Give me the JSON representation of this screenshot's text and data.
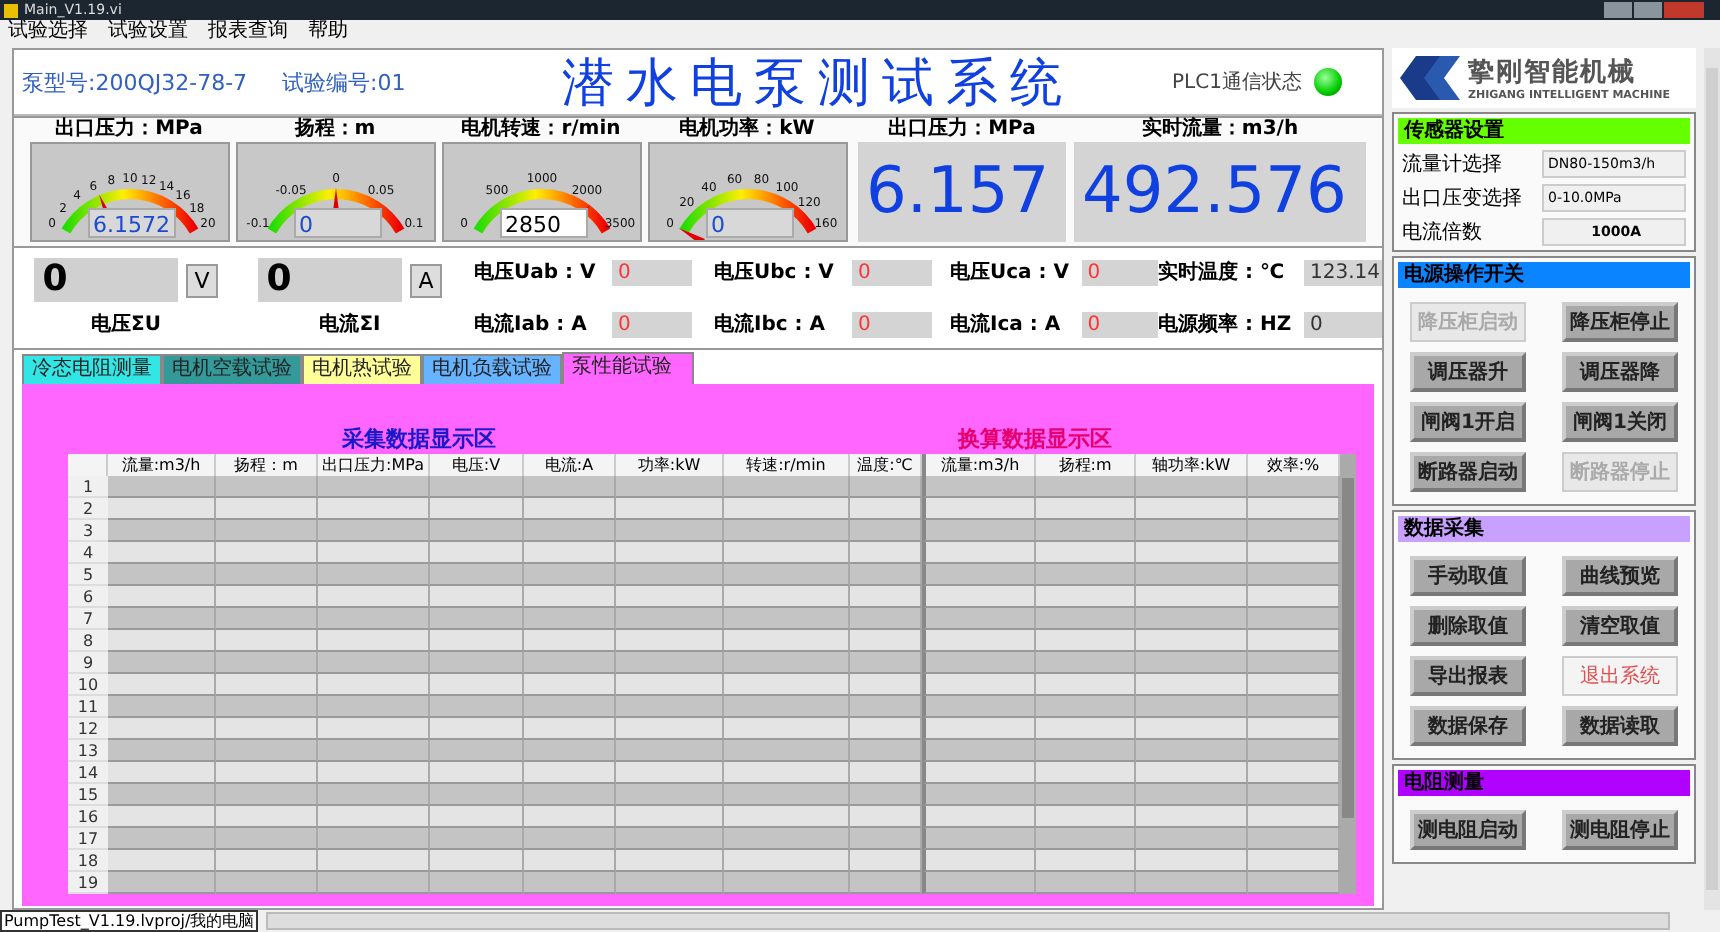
{
  "window": {
    "title": "Main_V1.19.vi"
  },
  "menu": [
    "试验选择",
    "试验设置",
    "报表查询",
    "帮助"
  ],
  "header": {
    "pump_model": "泵型号:200QJ32-78-7",
    "test_number": "试验编号:01",
    "title": "潜水电泵测试系统",
    "plc_label": "PLC1通信状态",
    "plc_ok": true
  },
  "logo": {
    "name": "挚刚智能机械",
    "subtitle": "ZHIGANG INTELLIGENT MACHINE"
  },
  "gauges": [
    {
      "label": "出口压力：MPa",
      "ticks": [
        "0",
        "2",
        "4",
        "6",
        "8",
        "10",
        "12",
        "14",
        "16",
        "18",
        "20"
      ],
      "value": "6.1572",
      "level": 0.31,
      "focused": false
    },
    {
      "label": "扬程：m",
      "ticks": [
        "-0.1",
        "-0.05",
        "0",
        "0.05",
        "0.1"
      ],
      "value": "0",
      "level": 0.5,
      "focused": false
    },
    {
      "label": "电机转速：r/min",
      "ticks": [
        "0",
        "500",
        "1000",
        "2000",
        "3500"
      ],
      "value": "2850",
      "level": 0.81,
      "focused": true
    },
    {
      "label": "电机功率：kW",
      "ticks": [
        "0",
        "20",
        "40",
        "60",
        "80",
        "100",
        "120",
        "160"
      ],
      "value": "0",
      "level": 0,
      "focused": false
    }
  ],
  "readouts": [
    {
      "label": "出口压力：MPa",
      "value": "6.157"
    },
    {
      "label": "实时流量：m3/h",
      "value": "492.576"
    }
  ],
  "totals": [
    {
      "label": "电压ΣU",
      "value": "0",
      "unit": "V"
    },
    {
      "label": "电流ΣI",
      "value": "0",
      "unit": "A"
    }
  ],
  "phases": [
    {
      "label": "电压Uab : V",
      "value": "0",
      "color": "#ff3333"
    },
    {
      "label": "电压Ubc : V",
      "value": "0",
      "color": "#ff3333"
    },
    {
      "label": "电压Uca : V",
      "value": "0",
      "color": "#ff3333"
    },
    {
      "label": "实时温度 : ℃",
      "value": "123.14",
      "color": "#333333"
    },
    {
      "label": "电流Iab : A",
      "value": "0",
      "color": "#ff3333"
    },
    {
      "label": "电流Ibc : A",
      "value": "0",
      "color": "#ff3333"
    },
    {
      "label": "电流Ica : A",
      "value": "0",
      "color": "#ff3333"
    },
    {
      "label": "电源频率 : HZ",
      "value": "0",
      "color": "#333333"
    }
  ],
  "tabs": [
    {
      "label": "冷态电阻测量",
      "color": "#33e6e6",
      "selected": false
    },
    {
      "label": "电机空载试验",
      "color": "#339999",
      "selected": false
    },
    {
      "label": "电机热试验",
      "color": "#ffff99",
      "selected": false
    },
    {
      "label": "电机负载试验",
      "color": "#66b3ff",
      "selected": false
    },
    {
      "label": "泵性能试验",
      "color": "#ff66ff",
      "selected": true
    }
  ],
  "table": {
    "sections": [
      {
        "title": "采集数据显示区",
        "color": "#1a1acc"
      },
      {
        "title": "换算数据显示区",
        "color": "#e6006e"
      }
    ],
    "columns": [
      "流量:m3/h",
      "扬程：m",
      "出口压力:MPa",
      "电压:V",
      "电流:A",
      "功率:kW",
      "转速:r/min",
      "温度:℃",
      "流量:m3/h",
      "扬程:m",
      "轴功率:kW",
      "效率:%"
    ],
    "rows": [
      "1",
      "2",
      "3",
      "4",
      "5",
      "6",
      "7",
      "8",
      "9",
      "10",
      "11",
      "12",
      "13",
      "14",
      "15",
      "16",
      "17",
      "18",
      "19"
    ]
  },
  "sensors": {
    "title": "传感器设置",
    "fields": [
      {
        "label": "流量计选择",
        "value": "DN80-150m3/h"
      },
      {
        "label": "出口压变选择",
        "value": "0-10.0MPa"
      },
      {
        "label": "电流倍数",
        "value": "1000A"
      }
    ]
  },
  "groups": [
    {
      "title": "电源操作开关",
      "color": "#0a84ff",
      "buttons": [
        {
          "label": "降压柜启动",
          "kind": "disabled"
        },
        {
          "label": "降压柜停止",
          "kind": "normal"
        },
        {
          "label": "调压器升",
          "kind": "normal"
        },
        {
          "label": "调压器降",
          "kind": "normal"
        },
        {
          "label": "闸阀1开启",
          "kind": "normal"
        },
        {
          "label": "闸阀1关闭",
          "kind": "normal"
        },
        {
          "label": "断路器启动",
          "kind": "normal"
        },
        {
          "label": "断路器停止",
          "kind": "disabled"
        }
      ]
    },
    {
      "title": "数据采集",
      "color": "#c8a0ff",
      "buttons": [
        {
          "label": "手动取值",
          "kind": "normal"
        },
        {
          "label": "曲线预览",
          "kind": "normal"
        },
        {
          "label": "删除取值",
          "kind": "normal"
        },
        {
          "label": "清空取值",
          "kind": "normal"
        },
        {
          "label": "导出报表",
          "kind": "normal"
        },
        {
          "label": "退出系统",
          "kind": "exit"
        },
        {
          "label": "数据保存",
          "kind": "normal"
        },
        {
          "label": "数据读取",
          "kind": "normal"
        }
      ]
    },
    {
      "title": "电阻测量",
      "color": "#b000ff",
      "buttons": [
        {
          "label": "测电阻启动",
          "kind": "normal"
        },
        {
          "label": "测电阻停止",
          "kind": "normal"
        }
      ]
    }
  ],
  "status_bar": {
    "path": "PumpTest_V1.19.lvproj/我的电脑"
  }
}
